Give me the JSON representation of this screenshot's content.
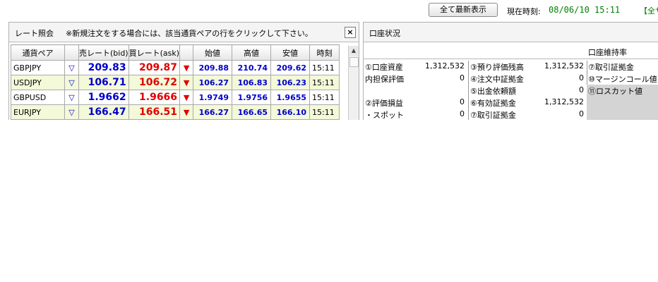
{
  "topbar": {
    "refresh_label": "全て最新表示",
    "clock_label": "現在時刻:",
    "clock_value": "08/06/10 15:11",
    "link_label": "【全サ"
  },
  "rate_panel": {
    "title": "レート照会",
    "note": "※新規注文をする場合には、該当通貨ペアの行をクリックして下さい。",
    "close_label": "×",
    "columns": [
      "通貨ペア",
      "",
      "売レート(bid)",
      "買レート(ask)",
      "",
      "始値",
      "高値",
      "安値",
      "時刻"
    ],
    "rows": [
      {
        "pair": "GBPJPY",
        "bid_dir": "▽",
        "bid": "209.83",
        "ask": "209.87",
        "ask_dir": "▼",
        "open": "209.88",
        "high": "210.74",
        "low": "209.62",
        "time": "15:11"
      },
      {
        "pair": "USDJPY",
        "bid_dir": "▽",
        "bid": "106.71",
        "ask": "106.72",
        "ask_dir": "▼",
        "open": "106.27",
        "high": "106.83",
        "low": "106.23",
        "time": "15:11"
      },
      {
        "pair": "GBPUSD",
        "bid_dir": "▽",
        "bid": "1.9662",
        "ask": "1.9666",
        "ask_dir": "▼",
        "open": "1.9749",
        "high": "1.9756",
        "low": "1.9655",
        "time": "15:11"
      },
      {
        "pair": "EURJPY",
        "bid_dir": "▽",
        "bid": "166.47",
        "ask": "166.51",
        "ask_dir": "▼",
        "open": "166.27",
        "high": "166.65",
        "low": "166.10",
        "time": "15:11"
      }
    ]
  },
  "account_panel": {
    "title": "口座状況",
    "margin_ratio_label": "口座維持率",
    "col_a": [
      {
        "label": "①口座資産",
        "value": "1,312,532"
      },
      {
        "label": "内担保評価",
        "value": "0"
      },
      {
        "label": "",
        "value": ""
      },
      {
        "label": "②評価損益",
        "value": "0"
      },
      {
        "label": "・スポット",
        "value": "0"
      }
    ],
    "col_b": [
      {
        "label": "③預り評価残高",
        "value": "1,312,532"
      },
      {
        "label": "④注文中証拠金",
        "value": "0"
      },
      {
        "label": "⑤出金依頼額",
        "value": "0"
      },
      {
        "label": "⑥有効証拠金",
        "value": "1,312,532"
      },
      {
        "label": "⑦取引証拠金",
        "value": "0"
      }
    ],
    "col_c": [
      {
        "label": "⑦取引証拠金"
      },
      {
        "label": "⑩マージンコール値"
      },
      {
        "label": "⑪ロスカット値"
      }
    ]
  }
}
